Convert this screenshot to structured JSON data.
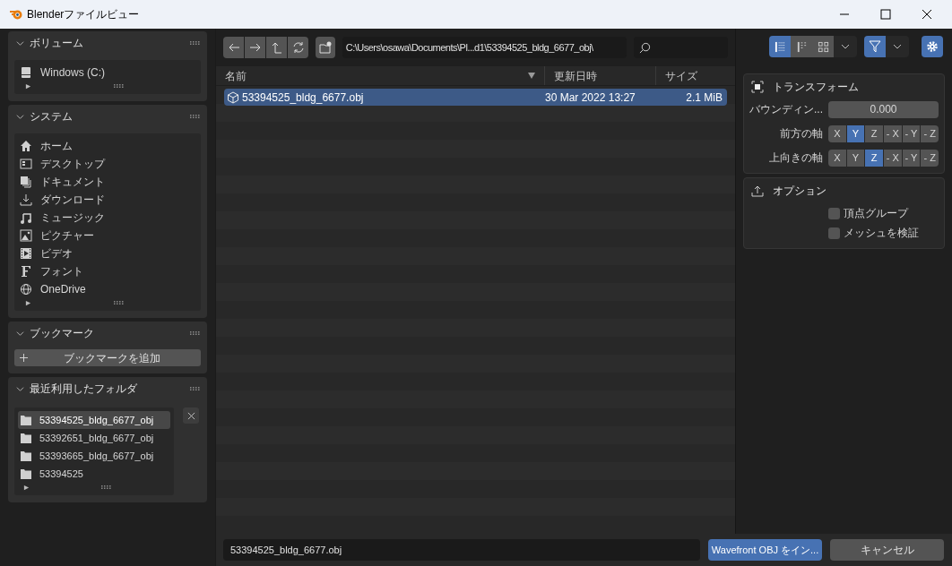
{
  "window": {
    "title": "Blenderファイルビュー"
  },
  "sidebar": {
    "panels": [
      {
        "kind": "list",
        "title": "ボリューム",
        "expanded": true,
        "items": [
          {
            "label": "Windows (C:)",
            "kind": "drive"
          }
        ]
      },
      {
        "kind": "list",
        "title": "システム",
        "expanded": true,
        "items": [
          {
            "label": "ホーム",
            "kind": "home"
          },
          {
            "label": "デスクトップ",
            "kind": "desktop"
          },
          {
            "label": "ドキュメント",
            "kind": "documents"
          },
          {
            "label": "ダウンロード",
            "kind": "download"
          },
          {
            "label": "ミュージック",
            "kind": "music"
          },
          {
            "label": "ピクチャー",
            "kind": "picture"
          },
          {
            "label": "ビデオ",
            "kind": "video"
          },
          {
            "label": "フォント",
            "kind": "font"
          },
          {
            "label": "OneDrive",
            "kind": "globe"
          }
        ]
      },
      {
        "kind": "button",
        "title": "ブックマーク",
        "expanded": true,
        "button": "ブックマークを追加"
      },
      {
        "kind": "recent",
        "title": "最近利用したフォルダ",
        "expanded": true,
        "items": [
          {
            "label": "53394525_bldg_6677_obj",
            "selected": true
          },
          {
            "label": "53392651_bldg_6677_obj",
            "selected": false
          },
          {
            "label": "53393665_bldg_6677_obj",
            "selected": false
          },
          {
            "label": "53394525",
            "selected": false
          }
        ]
      }
    ]
  },
  "toolbar": {
    "path": "C:\\Users\\osawa\\Documents\\Pl...d1\\53394525_bldg_6677_obj\\",
    "view_modes": [
      {
        "selected": true
      },
      {
        "selected": false
      },
      {
        "selected": false
      }
    ],
    "filter_on": true
  },
  "file_list": {
    "columns": [
      {
        "label": "名前",
        "sorted": true
      },
      {
        "label": "更新日時",
        "sorted": false
      },
      {
        "label": "サイズ",
        "sorted": false
      }
    ],
    "rows": [
      {
        "name": "53394525_bldg_6677.obj",
        "date": "30 Mar 2022 13:27",
        "size": "2.1 MiB",
        "selected": true
      }
    ]
  },
  "properties": {
    "transform": {
      "title": "トランスフォーム",
      "expanded": true,
      "bounding_label": "バウンディン...",
      "bounding_value": "0.000",
      "axes": [
        {
          "label": "前方の軸",
          "options": [
            {
              "label": "X",
              "selected": false
            },
            {
              "label": "Y",
              "selected": true
            },
            {
              "label": "Z",
              "selected": false
            },
            {
              "label": "- X",
              "selected": false
            },
            {
              "label": "- Y",
              "selected": false
            },
            {
              "label": "- Z",
              "selected": false
            }
          ]
        },
        {
          "label": "上向きの軸",
          "options": [
            {
              "label": "X",
              "selected": false
            },
            {
              "label": "Y",
              "selected": false
            },
            {
              "label": "Z",
              "selected": true
            },
            {
              "label": "- X",
              "selected": false
            },
            {
              "label": "- Y",
              "selected": false
            },
            {
              "label": "- Z",
              "selected": false
            }
          ]
        }
      ]
    },
    "options": {
      "title": "オプション",
      "checkboxes": [
        {
          "label": "頂点グループ",
          "checked": false
        },
        {
          "label": "メッシュを検証",
          "checked": false
        }
      ]
    }
  },
  "footer": {
    "filename": "53394525_bldg_6677.obj",
    "confirm": "Wavefront OBJ をイン...",
    "cancel": "キャンセル"
  }
}
